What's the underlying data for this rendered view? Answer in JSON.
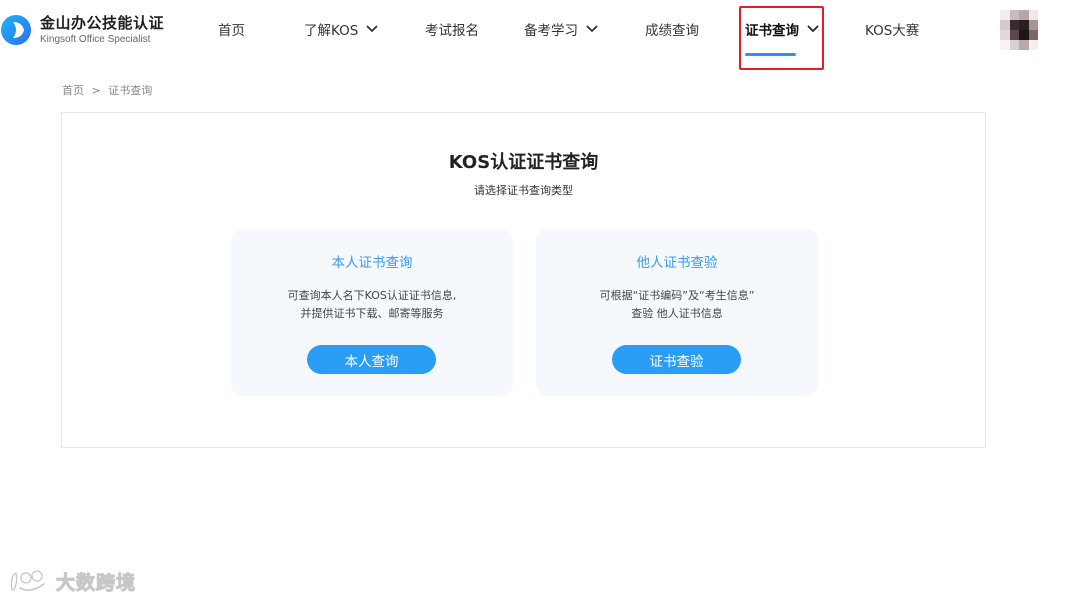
{
  "brand": {
    "name_cn": "金山办公技能认证",
    "name_en": "Kingsoft Office Specialist"
  },
  "nav": {
    "items": [
      {
        "label": "首页",
        "has_dropdown": false,
        "active": false
      },
      {
        "label": "了解KOS",
        "has_dropdown": true,
        "active": false
      },
      {
        "label": "考试报名",
        "has_dropdown": false,
        "active": false
      },
      {
        "label": "备考学习",
        "has_dropdown": true,
        "active": false
      },
      {
        "label": "成绩查询",
        "has_dropdown": false,
        "active": false
      },
      {
        "label": "证书查询",
        "has_dropdown": true,
        "active": true
      },
      {
        "label": "KOS大赛",
        "has_dropdown": false,
        "active": false
      }
    ],
    "accent_color": "#2a94f4",
    "highlight_color": "#e02020"
  },
  "breadcrumb": {
    "home": "首页",
    "separator": ">",
    "current": "证书查询"
  },
  "panel": {
    "title": "KOS认证证书查询",
    "subtitle": "请选择证书查询类型"
  },
  "cards": [
    {
      "title": "本人证书查询",
      "desc_line1": "可查询本人名下KOS认证证书信息,",
      "desc_line2": "并提供证书下载、邮寄等服务",
      "button": "本人查询"
    },
    {
      "title": "他人证书查验",
      "desc_line1": "可根据“证书编码”及“考生信息”",
      "desc_line2": "查验 他人证书信息",
      "button": "证书查验"
    }
  ],
  "watermark": {
    "text": "大数跨境"
  },
  "colors": {
    "card_bg": "#f5f9fd",
    "card_title": "#3a9bf0",
    "button_bg": "#2a9df4"
  },
  "icons": {
    "logo": "kingsoft-logo-icon",
    "dropdown": "chevron-down-icon",
    "avatar": "pixelated-avatar"
  }
}
